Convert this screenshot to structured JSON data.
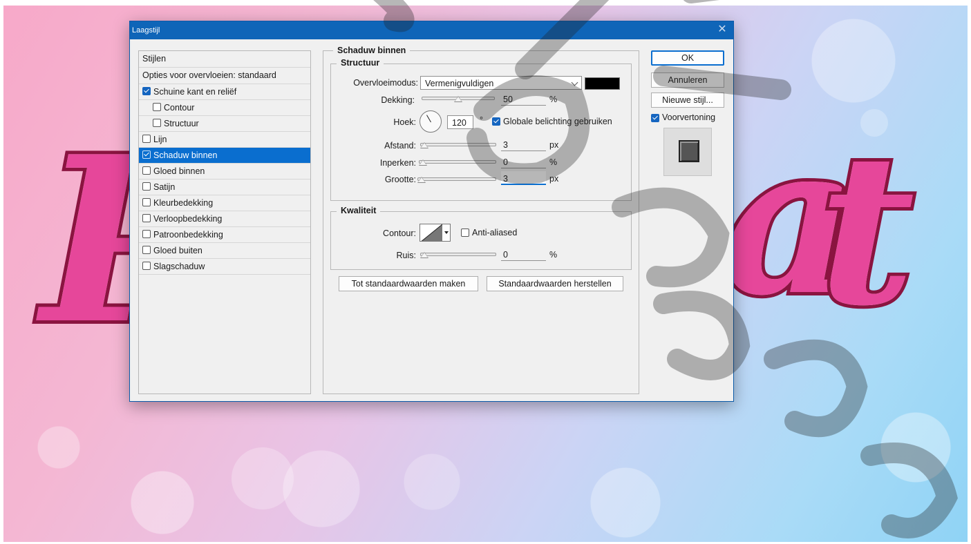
{
  "dialog": {
    "title": "Laagstijl",
    "close_glyph": "✕"
  },
  "styles_list": {
    "header": "Stijlen",
    "blend_options": "Opties voor overvloeien: standaard",
    "items": [
      {
        "label": "Schuine kant en reliëf",
        "checked": true,
        "indent": false,
        "selected": false
      },
      {
        "label": "Contour",
        "checked": false,
        "indent": true,
        "selected": false
      },
      {
        "label": "Structuur",
        "checked": false,
        "indent": true,
        "selected": false
      },
      {
        "label": "Lijn",
        "checked": false,
        "indent": false,
        "selected": false
      },
      {
        "label": "Schaduw binnen",
        "checked": true,
        "indent": false,
        "selected": true
      },
      {
        "label": "Gloed binnen",
        "checked": false,
        "indent": false,
        "selected": false
      },
      {
        "label": "Satijn",
        "checked": false,
        "indent": false,
        "selected": false
      },
      {
        "label": "Kleurbedekking",
        "checked": false,
        "indent": false,
        "selected": false
      },
      {
        "label": "Verloopbedekking",
        "checked": false,
        "indent": false,
        "selected": false
      },
      {
        "label": "Patroonbedekking",
        "checked": false,
        "indent": false,
        "selected": false
      },
      {
        "label": "Gloed buiten",
        "checked": false,
        "indent": false,
        "selected": false
      },
      {
        "label": "Slagschaduw",
        "checked": false,
        "indent": false,
        "selected": false
      }
    ]
  },
  "panel": {
    "section_title": "Schaduw binnen",
    "structure": {
      "title": "Structuur",
      "blend_mode_label": "Overvloeimodus:",
      "blend_mode_value": "Vermenigvuldigen",
      "shadow_color": "#000000",
      "opacity_label": "Dekking:",
      "opacity_value": "50",
      "opacity_fraction": 0.5,
      "opacity_unit": "%",
      "angle_label": "Hoek:",
      "angle_value": "120",
      "angle_unit": "°",
      "global_light_label": "Globale belichting gebruiken",
      "global_light_checked": true,
      "distance_label": "Afstand:",
      "distance_value": "3",
      "distance_unit": "px",
      "choke_label": "Inperken:",
      "choke_value": "0",
      "choke_unit": "%",
      "size_label": "Grootte:",
      "size_value": "3",
      "size_unit": "px"
    },
    "quality": {
      "title": "Kwaliteit",
      "contour_label": "Contour:",
      "anti_aliased_label": "Anti-aliased",
      "anti_aliased_checked": false,
      "noise_label": "Ruis:",
      "noise_value": "0",
      "noise_unit": "%"
    },
    "make_default_button": "Tot standaardwaarden maken",
    "reset_default_button": "Standaardwaarden herstellen"
  },
  "right": {
    "ok_button": "OK",
    "cancel_button": "Annuleren",
    "new_style_button": "Nieuwe stijl...",
    "preview_label": "Voorvertoning",
    "preview_checked": true
  }
}
